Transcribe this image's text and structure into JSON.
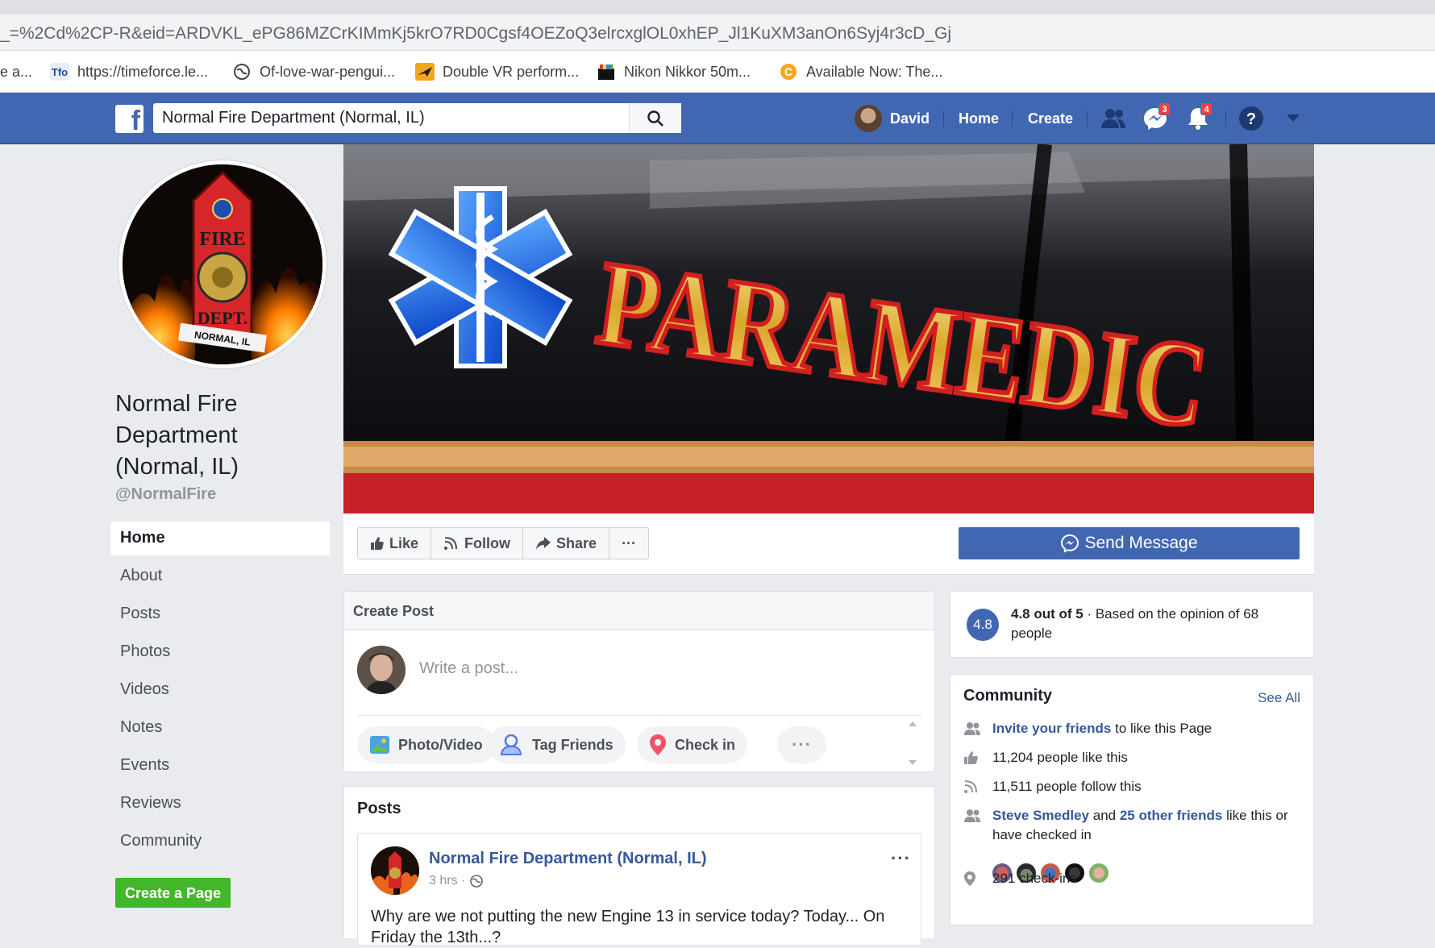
{
  "browser": {
    "url": "_=%2Cd%2CP-R&eid=ARDVKL_ePG86MZCrKIMmKj5krO7RD0Cgsf4OEZoQ3elrcxglOL0xhEP_Jl1KuXM3anOn6Syj4r3cD_Gj",
    "bookmarks": [
      {
        "label": "e a...",
        "icon": "page-icon"
      },
      {
        "label": "https://timeforce.le...",
        "icon": "tfo-icon"
      },
      {
        "label": "Of-love-war-pengui...",
        "icon": "globe-icon"
      },
      {
        "label": "Double VR perform...",
        "icon": "plane-icon"
      },
      {
        "label": "Nikon Nikkor 50m...",
        "icon": "shop-icon"
      },
      {
        "label": "Available Now: The...",
        "icon": "c-icon"
      }
    ]
  },
  "facebook_bar": {
    "search_value": "Normal Fire Department  (Normal, IL)",
    "user_name": "David",
    "home_label": "Home",
    "create_label": "Create",
    "messages_badge": "3",
    "notifications_badge": "4"
  },
  "page": {
    "name": "Normal Fire Department (Normal, IL)",
    "handle": "@NormalFire",
    "cover_text": "PARAMEDIC",
    "profile_text_top": "FIRE",
    "profile_text_mid": "DEPT.",
    "profile_text_bottom": "NORMAL, IL"
  },
  "left_nav": {
    "items": [
      "Home",
      "About",
      "Posts",
      "Photos",
      "Videos",
      "Notes",
      "Events",
      "Reviews",
      "Community"
    ],
    "create_page": "Create a Page"
  },
  "actions": {
    "like": "Like",
    "follow": "Follow",
    "share": "Share",
    "more": "···",
    "send_message": "Send Message"
  },
  "create_post": {
    "header": "Create Post",
    "placeholder": "Write a post...",
    "photo_video": "Photo/Video",
    "tag_friends": "Tag Friends",
    "check_in": "Check in",
    "more": "···"
  },
  "posts": {
    "header": "Posts",
    "first": {
      "author": "Normal Fire Department (Normal, IL)",
      "time": "3 hrs ·",
      "text": "Why are we not putting the new Engine 13 in service today? Today... On Friday the 13th...?",
      "more": "···"
    }
  },
  "rating": {
    "score": "4.8",
    "bold": "4.8 out of 5",
    "rest": " · Based on the opinion of 68 people"
  },
  "community": {
    "title": "Community",
    "see_all": "See All",
    "invite_link": "Invite your friends",
    "invite_rest": " to like this Page",
    "likes": "11,204 people like this",
    "follows": "11,511 people follow this",
    "friend_link": "Steve Smedley",
    "friend_and": " and ",
    "others_link": "25 other friends",
    "friends_rest": " like this or have checked in",
    "checkins": "291 check-ins"
  },
  "colors": {
    "fb_blue": "#4267b2",
    "link": "#365899",
    "green": "#42b72a",
    "badge_red": "#fa3e3e"
  }
}
